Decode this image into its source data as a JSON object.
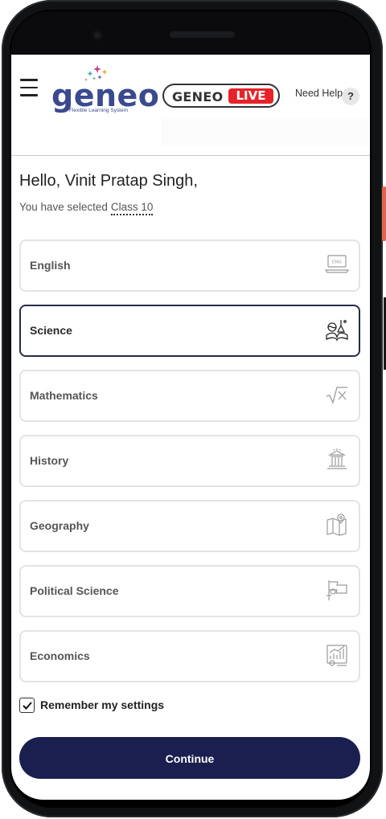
{
  "header": {
    "logo_text": "geneo",
    "logo_subtitle": "Flexible Learning System",
    "live_left": "GENEO",
    "live_right": "LIVE",
    "help_label": "Need Help",
    "help_icon": "?"
  },
  "greeting": "Hello, Vinit Pratap Singh,",
  "selection": {
    "prefix": "You have selected",
    "class_label": "Class 10"
  },
  "subjects": [
    {
      "label": "English",
      "icon": "eng-laptop-icon",
      "selected": false
    },
    {
      "label": "Science",
      "icon": "science-icon",
      "selected": true
    },
    {
      "label": "Mathematics",
      "icon": "square-root-icon",
      "selected": false
    },
    {
      "label": "History",
      "icon": "monument-icon",
      "selected": false
    },
    {
      "label": "Geography",
      "icon": "map-pin-icon",
      "selected": false
    },
    {
      "label": "Political Science",
      "icon": "flag-icon",
      "selected": false
    },
    {
      "label": "Economics",
      "icon": "growth-chart-icon",
      "selected": false
    }
  ],
  "remember": {
    "label": "Remember my settings",
    "checked": true
  },
  "continue_label": "Continue",
  "colors": {
    "primary": "#1b1f4f",
    "live_red": "#e52329",
    "logo_blue": "#3b4a8e"
  }
}
